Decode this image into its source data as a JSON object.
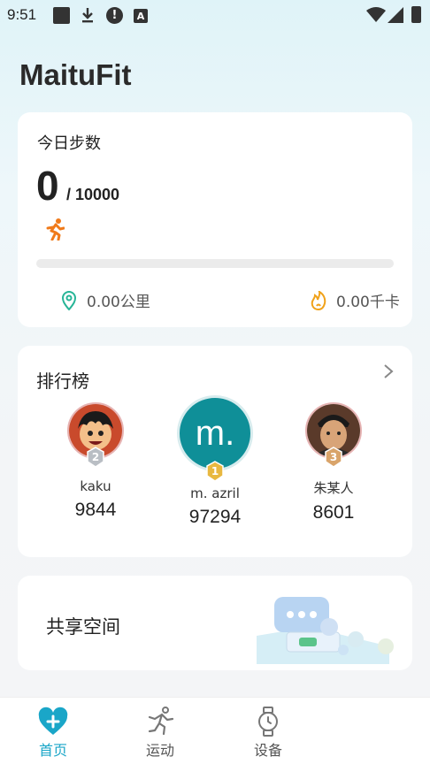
{
  "status_bar": {
    "time": "9:51",
    "alert_glyph": "!",
    "a_glyph": "A"
  },
  "app": {
    "title": "MaituFit"
  },
  "steps_card": {
    "label": "今日步数",
    "steps": "0",
    "goal": "/ 10000",
    "progress_fraction": 0,
    "distance": "0.00公里",
    "calories": "0.00千卡",
    "accent_color": "#2ab0c5"
  },
  "ranking": {
    "title": "排行榜",
    "entries": [
      {
        "rank": "2",
        "name": "kaku",
        "steps": "9844"
      },
      {
        "rank": "1",
        "name": "m. azril",
        "steps": "97294",
        "avatar_text": "m."
      },
      {
        "rank": "3",
        "name": "朱某人",
        "steps": "8601"
      }
    ]
  },
  "share": {
    "label": "共享空间"
  },
  "tabs": [
    {
      "label": "首页",
      "icon": "heart-plus-icon",
      "active": true,
      "color": "#1aa6c8"
    },
    {
      "label": "运动",
      "icon": "running-man-icon"
    },
    {
      "label": "设备",
      "icon": "watch-icon"
    }
  ]
}
